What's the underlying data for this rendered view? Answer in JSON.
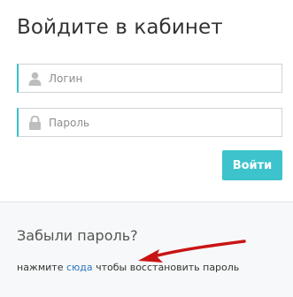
{
  "login": {
    "title": "Войдите в кабинет",
    "username_placeholder": "Логин",
    "password_placeholder": "Пароль",
    "submit_label": "Войти",
    "username_icon": "user-icon",
    "password_icon": "lock-icon"
  },
  "forgot": {
    "title": "Забыли пароль?",
    "prefix": "нажмите ",
    "link_label": "сюда",
    "suffix": " чтобы восстановить пароль"
  },
  "colors": {
    "accent": "#3cc3cc",
    "link": "#2a74c0",
    "annotation_arrow": "#c81414"
  }
}
